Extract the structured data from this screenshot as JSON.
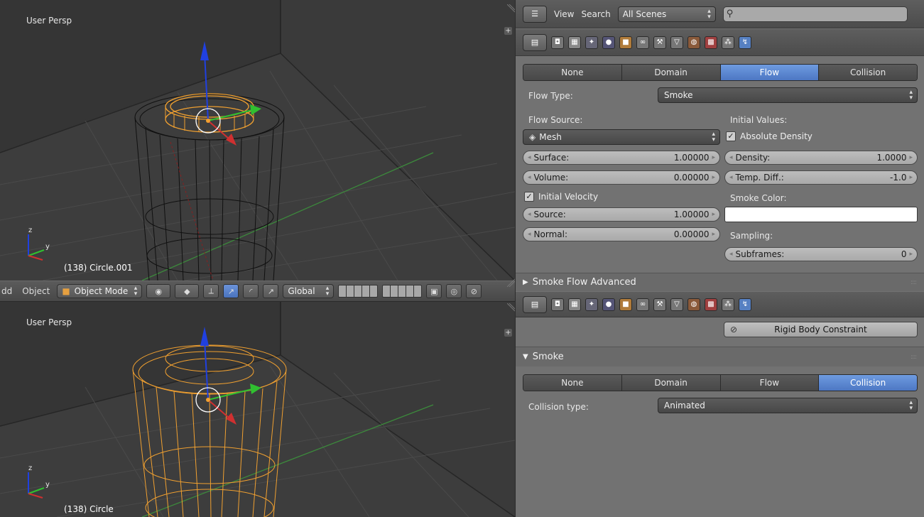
{
  "viewport_top": {
    "label": "User Persp",
    "object_name": "(138) Circle.001"
  },
  "viewport_bottom": {
    "label": "User Persp",
    "object_name": "(138) Circle"
  },
  "view3d_header": {
    "menu_add": "dd",
    "menu_object": "Object",
    "mode": "Object Mode",
    "orientation": "Global"
  },
  "properties_top": {
    "menu_view": "View",
    "menu_search": "Search",
    "scene_filter": "All Scenes",
    "search_value": ""
  },
  "smoke_flow": {
    "tabs": [
      {
        "label": "None"
      },
      {
        "label": "Domain"
      },
      {
        "label": "Flow"
      },
      {
        "label": "Collision"
      }
    ],
    "active_tab": "Flow",
    "flow_type_label": "Flow Type:",
    "flow_type_value": "Smoke",
    "flow_source_label": "Flow Source:",
    "flow_source_value": "Mesh",
    "initial_values_label": "Initial Values:",
    "absolute_density_label": "Absolute Density",
    "absolute_density_checked": true,
    "surface_label": "Surface:",
    "surface_value": "1.00000",
    "volume_label": "Volume:",
    "volume_value": "0.00000",
    "density_label": "Density:",
    "density_value": "1.0000",
    "temp_diff_label": "Temp. Diff.:",
    "temp_diff_value": "-1.0",
    "initial_velocity_label": "Initial Velocity",
    "initial_velocity_checked": true,
    "smoke_color_label": "Smoke Color:",
    "smoke_color": "#ffffff",
    "source_label": "Source:",
    "source_value": "1.00000",
    "normal_label": "Normal:",
    "normal_value": "0.00000",
    "sampling_label": "Sampling:",
    "subframes_label": "Subframes:",
    "subframes_value": "0",
    "advanced_label": "Smoke Flow Advanced"
  },
  "smoke_collision": {
    "rigid_body_constraint_label": "Rigid Body Constraint",
    "section_label": "Smoke",
    "tabs": [
      {
        "label": "None"
      },
      {
        "label": "Domain"
      },
      {
        "label": "Flow"
      },
      {
        "label": "Collision"
      }
    ],
    "active_tab": "Collision",
    "collision_type_label": "Collision type:",
    "collision_type_value": "Animated"
  },
  "colors": {
    "accent_blue": "#5680c2",
    "viewport_bg": "#393939",
    "panel_bg": "#727272",
    "selection_orange": "#f0a030",
    "axis_x_red": "#d03030",
    "axis_y_green": "#30c030",
    "axis_z_blue": "#2040e0"
  }
}
